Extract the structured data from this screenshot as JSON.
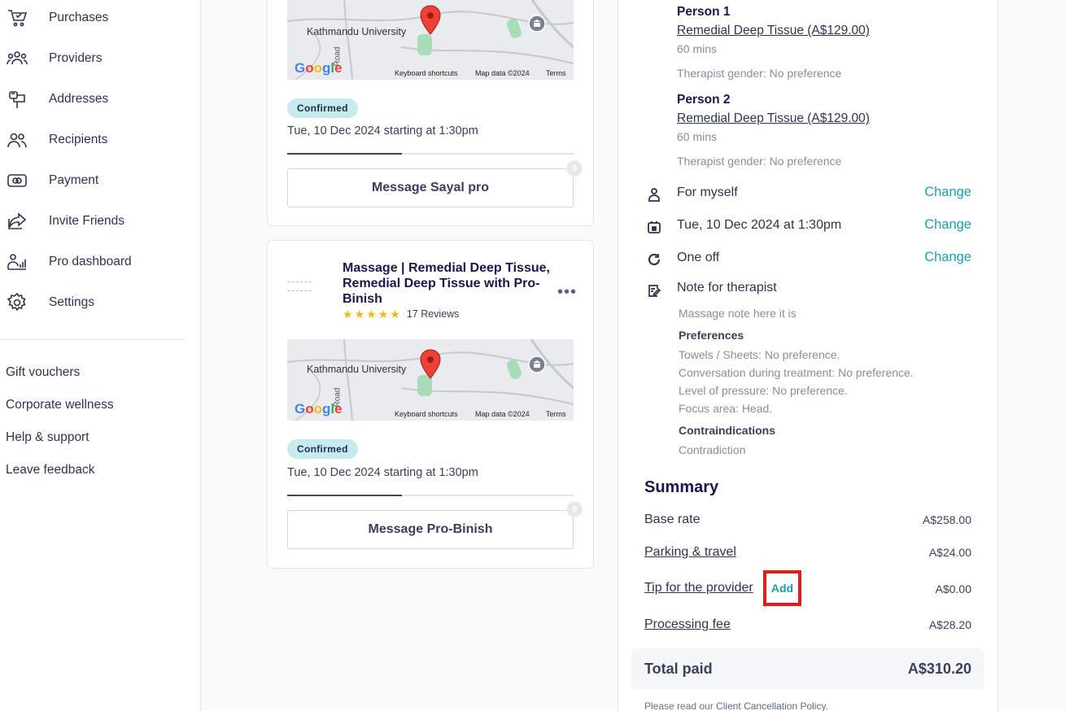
{
  "sidebar": {
    "items": [
      {
        "label": "Purchases",
        "icon": "cart-icon"
      },
      {
        "label": "Providers",
        "icon": "providers-icon"
      },
      {
        "label": "Addresses",
        "icon": "mailbox-icon"
      },
      {
        "label": "Recipients",
        "icon": "recipients-icon"
      },
      {
        "label": "Payment",
        "icon": "payment-icon"
      },
      {
        "label": "Invite Friends",
        "icon": "share-icon"
      },
      {
        "label": "Pro dashboard",
        "icon": "pro-dashboard-icon"
      },
      {
        "label": "Settings",
        "icon": "gear-icon"
      }
    ],
    "links": [
      "Gift vouchers",
      "Corporate wellness",
      "Help & support",
      "Leave feedback"
    ]
  },
  "bookings": [
    {
      "map": {
        "place": "Kathmandu University",
        "road": "Road",
        "attribution_shortcuts": "Keyboard shortcuts",
        "attribution_data": "Map data ©2024",
        "attribution_terms": "Terms",
        "brand": "Google"
      },
      "status": "Confirmed",
      "date": "Tue, 10 Dec 2024 starting at 1:30pm",
      "message_label": "Message Sayal pro",
      "unread": "0"
    },
    {
      "title": "Massage | Remedial Deep Tissue, Remedial Deep Tissue with Pro-Binish",
      "reviews": "17 Reviews",
      "rating": 5,
      "map": {
        "place": "Kathmandu University",
        "road": "Road",
        "attribution_shortcuts": "Keyboard shortcuts",
        "attribution_data": "Map data ©2024",
        "attribution_terms": "Terms",
        "brand": "Google"
      },
      "status": "Confirmed",
      "date": "Tue, 10 Dec 2024 starting at 1:30pm",
      "message_label": "Message Pro-Binish",
      "unread": "0"
    }
  ],
  "details": {
    "persons": [
      {
        "name": "Person 1",
        "service": "Remedial Deep Tissue (A$129.00)",
        "duration": "60 mins",
        "gender": "Therapist gender: No preference"
      },
      {
        "name": "Person 2",
        "service": "Remedial Deep Tissue (A$129.00)",
        "duration": "60 mins",
        "gender": "Therapist gender: No preference"
      }
    ],
    "recipient": "For myself",
    "datetime": "Tue, 10 Dec 2024 at 1:30pm",
    "frequency": "One off",
    "change_label": "Change",
    "note_label": "Note for therapist",
    "note": "Massage note here it is",
    "preferences_label": "Preferences",
    "preferences": [
      "Towels / Sheets: No preference.",
      "Conversation during treatment: No preference.",
      "Level of pressure: No preference.",
      "Focus area: Head."
    ],
    "contraindications_label": "Contraindications",
    "contraindications": "Contradiction"
  },
  "summary": {
    "title": "Summary",
    "base_rate_label": "Base rate",
    "base_rate": "A$258.00",
    "parking_label": "Parking & travel",
    "parking": "A$24.00",
    "tip_label": "Tip for the provider",
    "tip_add": "Add",
    "tip": "A$0.00",
    "processing_label": "Processing fee",
    "processing": "A$28.20",
    "total_label": "Total paid",
    "total": "A$310.20",
    "policy_prefix": "Please read our",
    "policy_link": "Client Cancellation Policy."
  },
  "colors": {
    "accent": "#1a9fb0",
    "heading": "#1f1450",
    "badge": "#c6eaf0",
    "highlight": "#e31b1b"
  }
}
